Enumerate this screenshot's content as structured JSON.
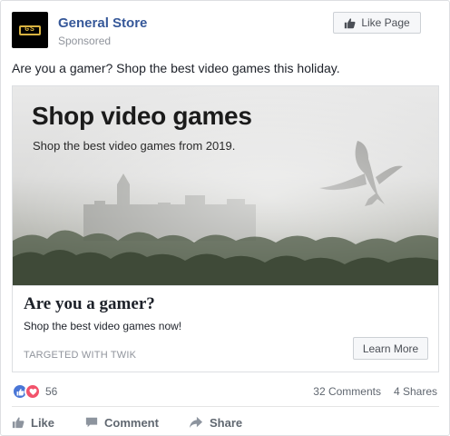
{
  "header": {
    "logo_text": "GS",
    "page_name": "General Store",
    "sponsored": "Sponsored",
    "like_page_label": "Like Page"
  },
  "post": {
    "text": "Are you a gamer? Shop the best video games this holiday."
  },
  "media": {
    "headline": "Shop video games",
    "subline": "Shop the best video games from 2019."
  },
  "link": {
    "title": "Are you a gamer?",
    "description": "Shop the best video games now!",
    "domain": "TARGETED WITH TWIK",
    "cta_label": "Learn More"
  },
  "engagement": {
    "reaction_count": "56",
    "comments": "32 Comments",
    "shares": "4 Shares"
  },
  "actions": {
    "like": "Like",
    "comment": "Comment",
    "share": "Share"
  },
  "colors": {
    "page_name": "#365899",
    "like_reaction": "#4a76d6",
    "love_reaction": "#f2536b",
    "logo_accent": "#d9b341"
  },
  "icons": [
    "thumbs-up-icon",
    "heart-icon",
    "comment-icon",
    "share-arrow-icon"
  ]
}
